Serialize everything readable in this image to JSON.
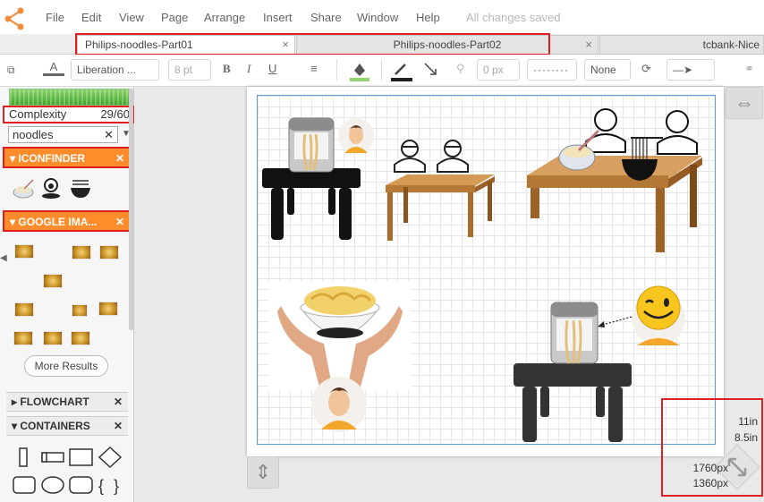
{
  "menu": {
    "items": [
      "File",
      "Edit",
      "View",
      "Page",
      "Arrange",
      "Insert",
      "Share",
      "Window",
      "Help"
    ],
    "status": "All changes saved"
  },
  "tabs": [
    {
      "label": "Philips-noodles-Part01",
      "close": "×"
    },
    {
      "label": "Philips-noodles-Part02",
      "close": "×"
    },
    {
      "label": "tcbank-Nice"
    }
  ],
  "toolbar": {
    "font": "Liberation ...",
    "font_size": "8 pt",
    "bold": "B",
    "italic": "I",
    "underline": "U",
    "spacing": "0 px",
    "arrow_style": "None",
    "font_color_letter": "A"
  },
  "sidebar": {
    "complexity_label": "Complexity",
    "complexity_value": "29/60",
    "complexity_fraction": 0.48,
    "search_value": "noodles",
    "sections": {
      "iconfinder": "ICONFINDER",
      "google": "GOOGLE IMA...",
      "flowchart": "FLOWCHART",
      "containers": "CONTAINERS"
    },
    "more_results": "More Results"
  },
  "canvas": {
    "page_width_in": "11in",
    "page_height_in": "8.5in",
    "page_width_px": "1760px",
    "page_height_px": "1360px"
  },
  "colors": {
    "accent": "#ff8c2a",
    "highlight": "#e02020",
    "grid_border": "#5a9bd5"
  }
}
